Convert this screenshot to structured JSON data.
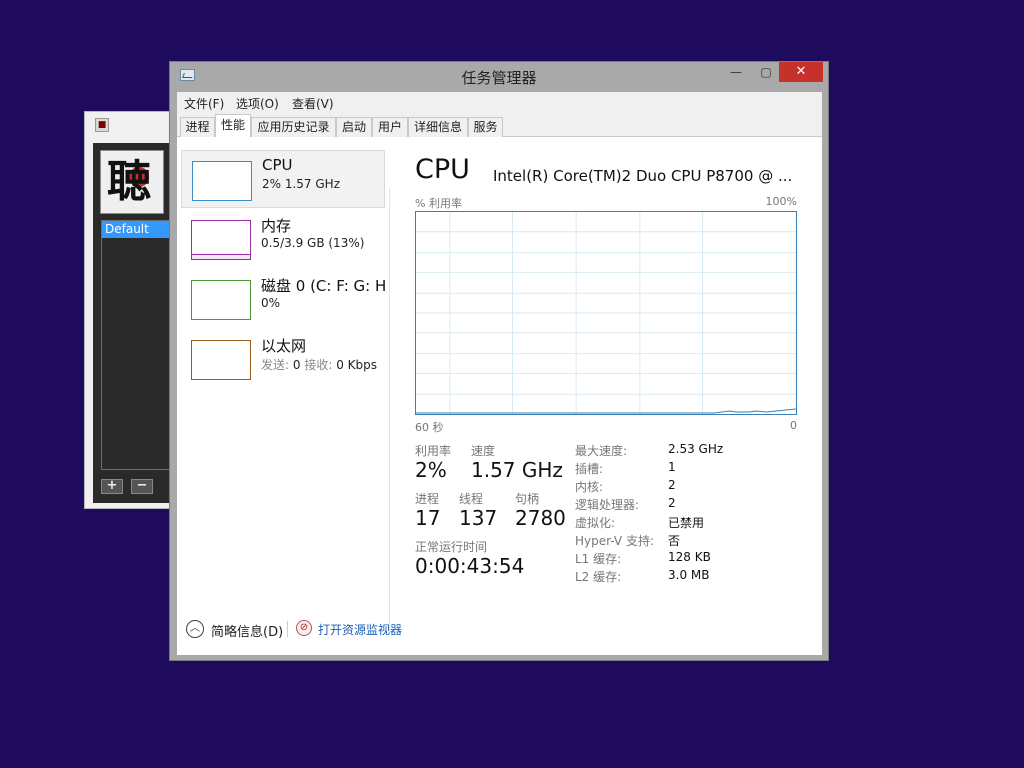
{
  "back_window": {
    "avatar_glyph": "聴",
    "list_selected": "Default",
    "add_label": "+",
    "remove_label": "−"
  },
  "window": {
    "title": "任务管理器",
    "minimize": "—",
    "maximize": "▢",
    "close": "✕"
  },
  "menu": [
    "文件(F)",
    "选项(O)",
    "查看(V)"
  ],
  "tabs": [
    "进程",
    "性能",
    "应用历史记录",
    "启动",
    "用户",
    "详细信息",
    "服务"
  ],
  "active_tab": "性能",
  "devices": [
    {
      "name": "CPU",
      "sub": "2% 1.57 GHz",
      "color": "#3a8dc9",
      "selected": true
    },
    {
      "name": "内存",
      "sub": "0.5/3.9 GB (13%)",
      "color": "#9b2aa8"
    },
    {
      "name": "磁盘 0 (C: F: G: H",
      "sub": "0%",
      "color": "#4a9a34"
    },
    {
      "name": "以太网",
      "send_label": "发送:",
      "send_val": "0",
      "recv_label": "接收:",
      "recv_val": "0 Kbps",
      "color": "#9c5a18"
    }
  ],
  "cpu": {
    "heading": "CPU",
    "model": "Intel(R) Core(TM)2 Duo CPU P8700 @ ...",
    "util_axis_label": "% 利用率",
    "util_max": "100%",
    "time_left": "60 秒",
    "time_right": "0",
    "graph_color": "#3a7fb3",
    "grid_color": "#d9e9f3",
    "stats": {
      "utilization_label": "利用率",
      "utilization": "2%",
      "speed_label": "速度",
      "speed": "1.57 GHz",
      "processes_label": "进程",
      "processes": "17",
      "threads_label": "线程",
      "threads": "137",
      "handles_label": "句柄",
      "handles": "2780",
      "uptime_label": "正常运行时间",
      "uptime": "0:00:43:54"
    },
    "details": [
      {
        "k": "最大速度:",
        "v": "2.53 GHz"
      },
      {
        "k": "插槽:",
        "v": "1"
      },
      {
        "k": "内核:",
        "v": "2"
      },
      {
        "k": "逻辑处理器:",
        "v": "2"
      },
      {
        "k": "虚拟化:",
        "v": "已禁用"
      },
      {
        "k": "Hyper-V 支持:",
        "v": "否"
      },
      {
        "k": "L1 缓存:",
        "v": "128 KB"
      },
      {
        "k": "L2 缓存:",
        "v": "3.0 MB"
      }
    ]
  },
  "bottom": {
    "fewer_details": "简略信息(D)",
    "resource_monitor": "打开资源监视器"
  }
}
